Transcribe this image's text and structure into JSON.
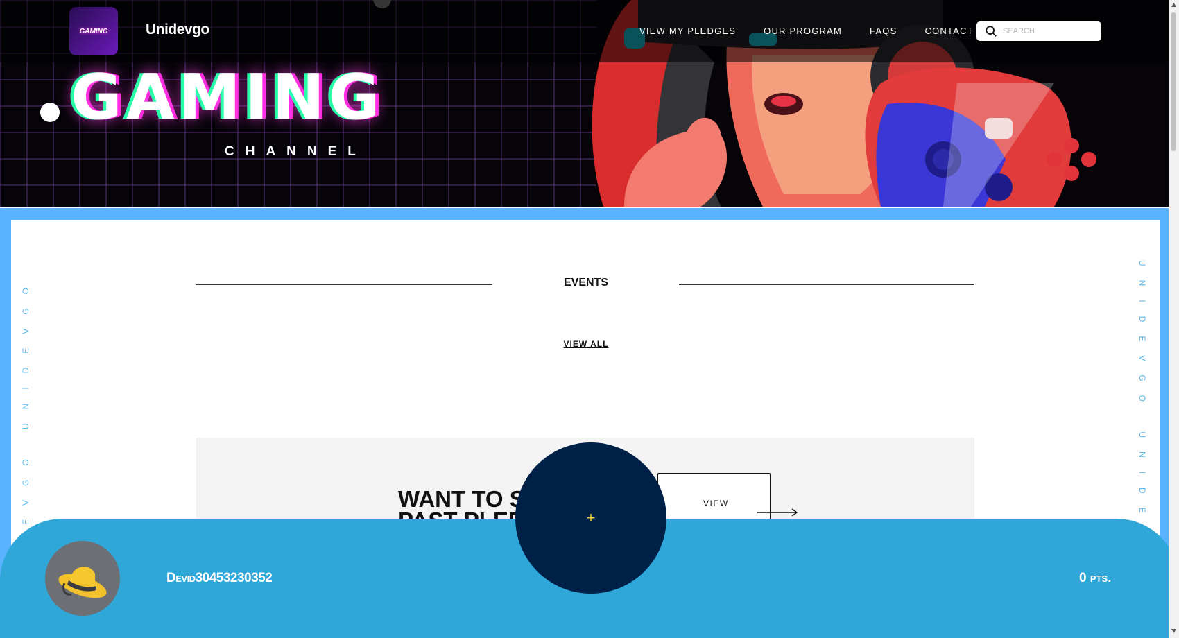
{
  "site": {
    "brand": "Unidevgo",
    "logo_text": "GAMING"
  },
  "nav": {
    "links": [
      "VIEW MY PLEDGES",
      "OUR PROGRAM",
      "FAQS",
      "CONTACT"
    ],
    "search_placeholder": "SEARCH"
  },
  "hero": {
    "title": "GAMING",
    "subtitle": "CHANNEL"
  },
  "side_text": {
    "left": "UNIDEVGO UNIDEVGO",
    "right": "UNIDEVGO UNIDE"
  },
  "events": {
    "title": "EVENTS",
    "view_all": "VIEW ALL"
  },
  "promo": {
    "heading": "WANT TO S",
    "heading_line2": "PAST PLEDG",
    "view_button": "VIEW"
  },
  "user": {
    "username": "Devid30453230352",
    "points": "0 pts."
  },
  "fab": {
    "symbol": "+"
  },
  "colors": {
    "frame_blue": "#5bb2ff",
    "bar_blue": "#2fa7d9",
    "fab_navy": "#002147",
    "accent_yellow": "#f2c94c"
  },
  "icons": [
    "search-icon",
    "hat-icon",
    "plus-icon",
    "arrow-right-icon"
  ]
}
